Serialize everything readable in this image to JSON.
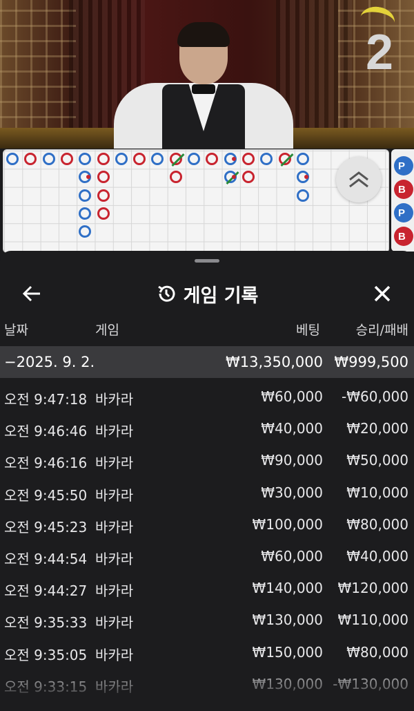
{
  "video": {
    "countdown": "2"
  },
  "roadmap": {
    "beads": [
      {
        "c": 0,
        "r": 0,
        "t": "p"
      },
      {
        "c": 1,
        "r": 0,
        "t": "b"
      },
      {
        "c": 2,
        "r": 0,
        "t": "p"
      },
      {
        "c": 3,
        "r": 0,
        "t": "b"
      },
      {
        "c": 4,
        "r": 0,
        "t": "p"
      },
      {
        "c": 4,
        "r": 1,
        "t": "p",
        "dots": [
          "b"
        ]
      },
      {
        "c": 4,
        "r": 3,
        "t": "p"
      },
      {
        "c": 4,
        "r": 4,
        "t": "p"
      },
      {
        "c": 5,
        "r": 0,
        "t": "b"
      },
      {
        "c": 5,
        "r": 1,
        "t": "b"
      },
      {
        "c": 5,
        "r": 2,
        "t": "b"
      },
      {
        "c": 5,
        "r": 3,
        "t": "b"
      },
      {
        "c": 4,
        "r": 2,
        "t": "p"
      },
      {
        "c": 6,
        "r": 0,
        "t": "p"
      },
      {
        "c": 7,
        "r": 0,
        "t": "b"
      },
      {
        "c": 8,
        "r": 0,
        "t": "p"
      },
      {
        "c": 9,
        "r": 0,
        "t": "b",
        "tie": true
      },
      {
        "c": 9,
        "r": 1,
        "t": "b"
      },
      {
        "c": 10,
        "r": 0,
        "t": "p"
      },
      {
        "c": 11,
        "r": 0,
        "t": "b"
      },
      {
        "c": 12,
        "r": 0,
        "t": "p",
        "dots": [
          "b"
        ]
      },
      {
        "c": 12,
        "r": 1,
        "t": "p",
        "tie": true,
        "dots": [
          "b"
        ]
      },
      {
        "c": 13,
        "r": 0,
        "t": "b"
      },
      {
        "c": 13,
        "r": 1,
        "t": "b"
      },
      {
        "c": 14,
        "r": 0,
        "t": "p"
      },
      {
        "c": 15,
        "r": 0,
        "t": "b",
        "tie": true
      },
      {
        "c": 16,
        "r": 0,
        "t": "p"
      },
      {
        "c": 16,
        "r": 1,
        "t": "p",
        "dots": [
          "b"
        ]
      },
      {
        "c": 16,
        "r": 2,
        "t": "p"
      }
    ],
    "side_beads": [
      {
        "label": "P",
        "color": "#2f6fc6"
      },
      {
        "label": "B",
        "color": "#c8242f"
      },
      {
        "label": "P",
        "color": "#2f6fc6"
      },
      {
        "label": "B",
        "color": "#c8242f"
      }
    ],
    "colors": {
      "player": "#2f6fc6",
      "banker": "#c8242f",
      "tie": "#2a8a3a"
    }
  },
  "panel": {
    "title": "게임 기록",
    "columns": {
      "date": "날짜",
      "game": "게임",
      "bet": "베팅",
      "win_loss": "승리/패배"
    },
    "date_group": {
      "date": "−2025. 9. 2.",
      "bet": "₩13,350,000",
      "win_loss": "₩999,500"
    },
    "rows": [
      {
        "time": "오전 9:47:18",
        "game": "바카라",
        "bet": "₩60,000",
        "win_loss": "-₩60,000"
      },
      {
        "time": "오전 9:46:46",
        "game": "바카라",
        "bet": "₩40,000",
        "win_loss": "₩20,000"
      },
      {
        "time": "오전 9:46:16",
        "game": "바카라",
        "bet": "₩90,000",
        "win_loss": "₩50,000"
      },
      {
        "time": "오전 9:45:50",
        "game": "바카라",
        "bet": "₩30,000",
        "win_loss": "₩10,000"
      },
      {
        "time": "오전 9:45:23",
        "game": "바카라",
        "bet": "₩100,000",
        "win_loss": "₩80,000"
      },
      {
        "time": "오전 9:44:54",
        "game": "바카라",
        "bet": "₩60,000",
        "win_loss": "₩40,000"
      },
      {
        "time": "오전 9:44:27",
        "game": "바카라",
        "bet": "₩140,000",
        "win_loss": "₩120,000"
      },
      {
        "time": "오전 9:35:33",
        "game": "바카라",
        "bet": "₩130,000",
        "win_loss": "₩110,000"
      },
      {
        "time": "오전 9:35:05",
        "game": "바카라",
        "bet": "₩150,000",
        "win_loss": "₩80,000"
      },
      {
        "time": "오전 9:33:15",
        "game": "바카라",
        "bet": "₩130,000",
        "win_loss": "-₩130,000"
      }
    ]
  }
}
